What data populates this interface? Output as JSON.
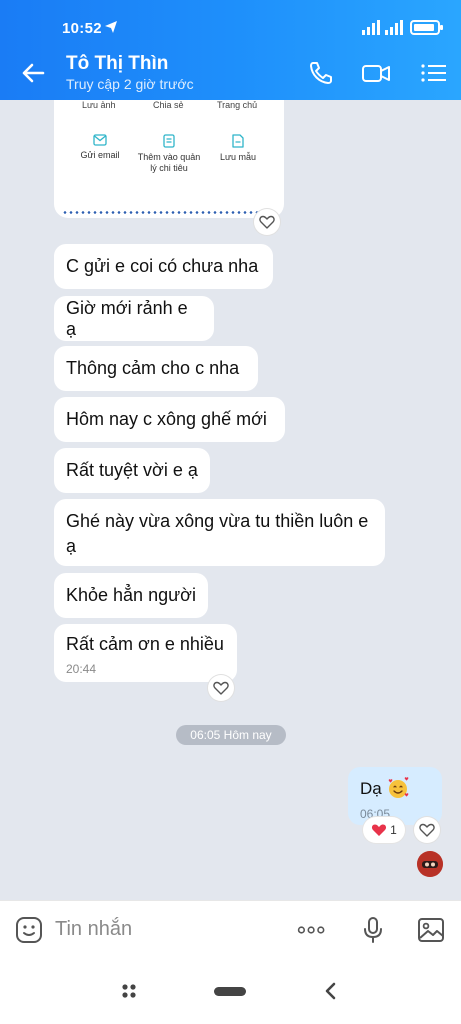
{
  "status": {
    "time": "10:52"
  },
  "header": {
    "contact_name": "Tô Thị Thìn",
    "last_seen": "Truy cập 2 giờ trước"
  },
  "card": {
    "top_labels": [
      "Lưu ảnh",
      "Chia sẻ",
      "Trang chủ"
    ],
    "actions": [
      {
        "label": "Gửi email",
        "icon": "mail-icon"
      },
      {
        "label": "Thêm vào quản lý chi tiêu",
        "icon": "ledger-icon"
      },
      {
        "label": "Lưu mẫu",
        "icon": "document-icon"
      }
    ]
  },
  "messages": [
    {
      "text": "C gửi e coi có chưa nha"
    },
    {
      "text": "Giờ mới rảnh e ạ"
    },
    {
      "text": "Thông cảm cho c nha"
    },
    {
      "text": "Hôm nay c xông ghế mới"
    },
    {
      "text": "Rất tuyệt vời e ạ"
    },
    {
      "text": "Ghé này vừa xông vừa tu thiền luôn e ạ"
    },
    {
      "text": "Khỏe hẳn người"
    },
    {
      "text": "Rất cảm ơn e nhiều",
      "time": "20:44"
    }
  ],
  "date_separator": "06:05 Hôm nay",
  "my_message": {
    "text": "Dạ",
    "emoji": "smiling-face-with-hearts",
    "time": "06:05",
    "reaction_count": "1"
  },
  "input": {
    "placeholder": "Tin nhắn"
  },
  "colors": {
    "header_start": "#1a7cf5",
    "header_end": "#2aa6ff",
    "chat_bg": "#e3e7ee",
    "my_bubble": "#d6ecff"
  }
}
